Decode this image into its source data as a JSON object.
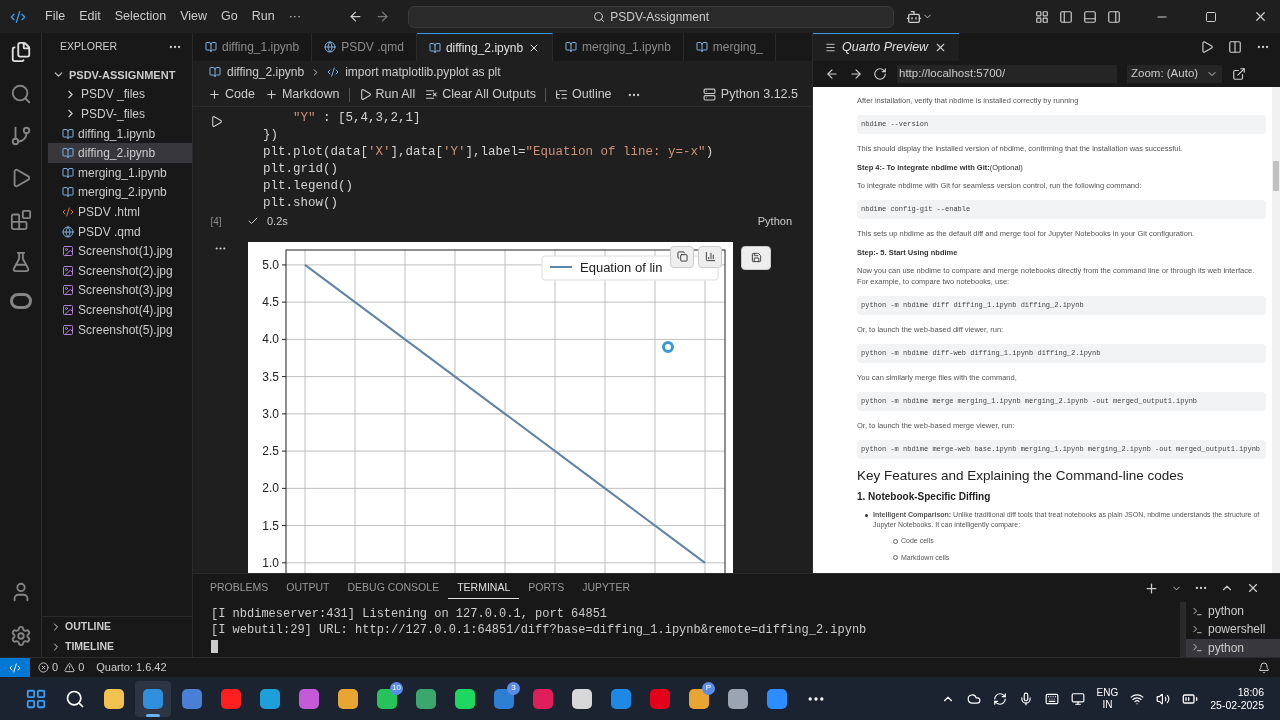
{
  "menu": [
    "File",
    "Edit",
    "Selection",
    "View",
    "Go",
    "Run",
    "···"
  ],
  "command_center": "PSDV-Assignment",
  "explorer": {
    "title": "EXPLORER",
    "tree": [
      {
        "label": "PSDV-ASSIGNMENT",
        "kind": "root",
        "expanded": true,
        "selected": false,
        "children": [
          {
            "label": "PSDV _files",
            "kind": "folder",
            "expanded": false,
            "selected": false
          },
          {
            "label": "PSDV-_files",
            "kind": "folder",
            "expanded": false,
            "selected": false
          },
          {
            "label": "diffing_1.ipynb",
            "kind": "notebook",
            "selected": false
          },
          {
            "label": "diffing_2.ipynb",
            "kind": "notebook",
            "selected": true
          },
          {
            "label": "merging_1.ipynb",
            "kind": "notebook",
            "selected": false
          },
          {
            "label": "merging_2.ipynb",
            "kind": "notebook",
            "selected": false
          },
          {
            "label": "PSDV .html",
            "kind": "html",
            "selected": false
          },
          {
            "label": "PSDV .qmd",
            "kind": "qmd",
            "selected": false
          },
          {
            "label": "Screenshot(1).jpg",
            "kind": "image",
            "selected": false
          },
          {
            "label": "Screenshot(2).jpg",
            "kind": "image",
            "selected": false
          },
          {
            "label": "Screenshot(3).jpg",
            "kind": "image",
            "selected": false
          },
          {
            "label": "Screenshot(4).jpg",
            "kind": "image",
            "selected": false
          },
          {
            "label": "Screenshot(5).jpg",
            "kind": "image",
            "selected": false
          }
        ]
      }
    ],
    "sections": [
      "OUTLINE",
      "TIMELINE"
    ]
  },
  "tabs": [
    {
      "label": "diffing_1.ipynb",
      "kind": "notebook",
      "selected": false
    },
    {
      "label": "PSDV .qmd",
      "kind": "qmd",
      "selected": false
    },
    {
      "label": "diffing_2.ipynb",
      "kind": "notebook",
      "selected": true
    },
    {
      "label": "merging_1.ipynb",
      "kind": "notebook",
      "selected": false
    },
    {
      "label": "merging_",
      "kind": "notebook",
      "selected": false
    }
  ],
  "breadcrumb": [
    "diffing_2.ipynb",
    "import matplotlib.pyplot as plt"
  ],
  "notebook_toolbar": [
    "Code",
    "Markdown",
    "Run All",
    "Clear All Outputs",
    "Outline"
  ],
  "kernel": "Python 3.12.5",
  "cell": {
    "lines": [
      "    \"Y\" : [5,4,3,2,1]",
      "})",
      "plt.plot(data['X'],data['Y'],label=\"Equation of line: y=-x\")",
      "plt.grid()",
      "plt.legend()",
      "plt.show()"
    ],
    "execution_count": "[4]",
    "duration": "0.2s",
    "language": "Python",
    "output": {
      "chart_data": {
        "type": "line",
        "grid": true,
        "ylim": [
          0.85,
          5.2
        ],
        "yticks": [
          {
            "value": 5,
            "label": "5.0"
          },
          {
            "value": 4.5,
            "label": "4.5"
          },
          {
            "value": 4,
            "label": "4.0"
          },
          {
            "value": 3.5,
            "label": "3.5"
          },
          {
            "value": 3,
            "label": "3.0"
          },
          {
            "value": 2.5,
            "label": "2.5"
          },
          {
            "value": 2,
            "label": "2.0"
          },
          {
            "value": 1.5,
            "label": "1.5"
          },
          {
            "value": 1,
            "label": "1.0"
          }
        ],
        "series": [
          {
            "name": "Equation of lin",
            "color": "#5f84a8",
            "values": [
              5,
              4,
              3,
              2,
              1
            ]
          }
        ]
      }
    }
  },
  "preview": {
    "title": "Quarto Preview",
    "url": "http://localhost:5700/",
    "zoom": "Zoom: (Auto)",
    "blocks": [
      {
        "kind": "p",
        "text": "After installation, verify that nbdime is installed correctly by running"
      },
      {
        "kind": "code",
        "text": "nbdime --version"
      },
      {
        "kind": "p",
        "text": "This should display the installed version of nbdime, confirming that the installation was successful."
      },
      {
        "kind": "step",
        "text": "**Step 4:- To integrate nbdime with Git:**(Optional)"
      },
      {
        "kind": "p",
        "text": "To integrate nbdime with Git for seamless version control, run the following command:"
      },
      {
        "kind": "code",
        "text": "nbdime config-git --enable"
      },
      {
        "kind": "p",
        "text": "This sets up nbdime as the default diff and merge tool for Jupyter Notebooks in your Git configuration."
      },
      {
        "kind": "step",
        "text": "**Step:- 5. Start Using nbdime**"
      },
      {
        "kind": "p",
        "text": "Now you can use nbdime to compare and merge notebooks directly from the command line or through its web interface. For example, to compare two notebooks, use:"
      },
      {
        "kind": "code",
        "text": "python -m nbdime diff diffing_1.ipynb diffing_2.ipynb"
      },
      {
        "kind": "p",
        "text": "Or, to launch the web-based diff viewer, run:"
      },
      {
        "kind": "code",
        "text": "python -m nbdime diff-web diffing_1.ipynb diffing_2.ipynb"
      },
      {
        "kind": "p",
        "text": "You can similarly merge files with the command,"
      },
      {
        "kind": "code",
        "text": "python -m nbdime merge merging_1.ipynb merging_2.ipynb -out merged_output1.ipynb"
      },
      {
        "kind": "p",
        "text": "Or, to launch the web-based merge viewer, run:"
      },
      {
        "kind": "code",
        "text": "python -m nbdime merge-web base.ipynb merging_1.ipynb merging_2.ipynb -out merged_output1.ipynb"
      },
      {
        "kind": "h1",
        "text": "Key Features and Explaining the Command-line codes"
      },
      {
        "kind": "h2",
        "text": "1. Notebook-Specific Diffing"
      },
      {
        "kind": "bullet",
        "text": "**Intelligent Comparison:** Unlike traditional diff tools that treat notebooks as plain JSON, nbdime understands the structure of Jupyter Notebooks. It can intelligently compare:"
      },
      {
        "kind": "sub",
        "text": "Code cells"
      },
      {
        "kind": "sub",
        "text": "Markdown cells"
      }
    ]
  },
  "panel": {
    "tabs": [
      {
        "label": "PROBLEMS",
        "selected": false
      },
      {
        "label": "OUTPUT",
        "selected": false
      },
      {
        "label": "DEBUG CONSOLE",
        "selected": false
      },
      {
        "label": "TERMINAL",
        "selected": true
      },
      {
        "label": "PORTS",
        "selected": false
      },
      {
        "label": "JUPYTER",
        "selected": false
      }
    ],
    "lines": [
      "[I nbdimeserver:431] Listening on 127.0.0.1, port 64851",
      "[I webutil:29] URL: http://127.0.0.1:64851/diff?base=diffing_1.ipynb&remote=diffing_2.ipynb"
    ],
    "terminals": [
      {
        "label": "python",
        "selected": false
      },
      {
        "label": "powershell",
        "selected": false
      },
      {
        "label": "python",
        "selected": true
      }
    ]
  },
  "status_bar": {
    "errors": "0",
    "warnings": "0",
    "quarto": "Quarto: 1.6.42"
  },
  "taskbar": {
    "apps": [
      {
        "kind": "start",
        "color": "#3b9cf0",
        "selected": false
      },
      {
        "kind": "search",
        "color": "#ffffff",
        "selected": false
      },
      {
        "kind": "app",
        "color": "#f2c14e",
        "selected": false
      },
      {
        "kind": "app",
        "color": "#2f8fdc",
        "selected": true
      },
      {
        "kind": "app",
        "color": "#4a7fd6",
        "selected": false
      },
      {
        "kind": "app",
        "color": "#ff1f1f",
        "selected": false
      },
      {
        "kind": "app",
        "color": "#1f9fd8",
        "selected": false
      },
      {
        "kind": "app",
        "color": "#c45ad8",
        "selected": false
      },
      {
        "kind": "app",
        "color": "#e9a531",
        "selected": false
      },
      {
        "kind": "app",
        "color": "#27c25a",
        "badge": "10",
        "selected": false
      },
      {
        "kind": "app",
        "color": "#3aa76d",
        "selected": false
      },
      {
        "kind": "app",
        "color": "#1ed760",
        "selected": false
      },
      {
        "kind": "app",
        "color": "#2d7fd3",
        "badge": "3",
        "selected": false
      },
      {
        "kind": "app",
        "color": "#e01e5a",
        "selected": false
      },
      {
        "kind": "app",
        "color": "#d8d8d8",
        "selected": false
      },
      {
        "kind": "app",
        "color": "#1e88e5",
        "selected": false
      },
      {
        "kind": "app",
        "color": "#e3001b",
        "selected": false
      },
      {
        "kind": "app",
        "color": "#e9a531",
        "badge": "P",
        "selected": false
      },
      {
        "kind": "app",
        "color": "#9aa4b2",
        "selected": false
      },
      {
        "kind": "app",
        "color": "#2d8cff",
        "selected": false
      },
      {
        "kind": "more",
        "color": "#ffffff",
        "selected": false
      }
    ],
    "language": [
      "ENG",
      "IN"
    ],
    "time": "18:06",
    "date": "25-02-2025"
  }
}
